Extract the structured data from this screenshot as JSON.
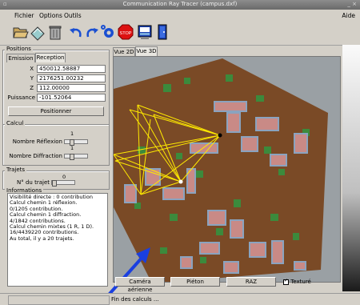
{
  "window": {
    "title": "Communication Ray Tracer (campus.dxf)",
    "controls": "_ ×"
  },
  "menu": {
    "items": [
      "Fichier",
      "Options",
      "Outils"
    ],
    "help": "Aide"
  },
  "toolbar": {
    "icons": [
      "open-folder-icon",
      "erase-icon",
      "trash-icon",
      "undo-icon",
      "redo-icon",
      "compute-icon",
      "stop-icon",
      "display-icon",
      "exit-icon"
    ],
    "stop_label": "STOP"
  },
  "positions": {
    "title": "Positions",
    "tabs": [
      "Emission",
      "Reception"
    ],
    "active_tab": "Reception",
    "fields": [
      {
        "label": "X",
        "value": "450012.58887"
      },
      {
        "label": "Y",
        "value": "2176251.00232"
      },
      {
        "label": "Z",
        "value": "112.00000"
      },
      {
        "label": "Puissance",
        "value": "-101.52064"
      }
    ],
    "button": "Positionner"
  },
  "calcul": {
    "title": "Calcul",
    "reflexion": {
      "label": "Nombre Réflexion",
      "value": "1"
    },
    "diffraction": {
      "label": "Nombre Diffraction",
      "value": "1"
    }
  },
  "trajets": {
    "title": "Trajets",
    "label": "N° du trajet",
    "value": "0"
  },
  "informations": {
    "title": "Informations",
    "lines": [
      "Visibilité directe : 0 contribution",
      "Calcul chemin 1 réflexion.",
      "      0/1205 contribution.",
      "Calcul chemin 1 diffraction.",
      "      4/1842 contributions.",
      "Calcul chemin mixtes (1 R, 1 D).",
      "      16/4439220 contributions.",
      "Au total, il y a 20 trajets."
    ]
  },
  "view": {
    "tabs": [
      "Vue 2D",
      "Vue 3D"
    ],
    "active_tab": "Vue 3D",
    "buttons": {
      "camera": "Caméra aérienne",
      "pieton": "Piéton",
      "raz": "RAZ"
    },
    "textured": {
      "label": "Texturé",
      "checked": true
    }
  },
  "status": {
    "text": "Fin des calculs ..."
  },
  "colors": {
    "ground": "#7a4a26",
    "rays": "#ffea00",
    "sky": "#9aa0a4",
    "building": "#c98a86",
    "tree": "#3c8a3c"
  }
}
